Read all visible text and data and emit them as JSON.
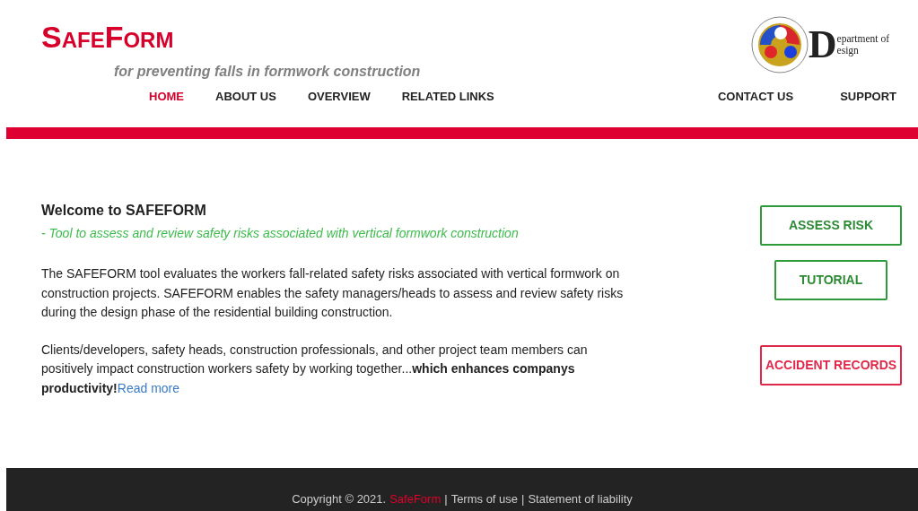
{
  "brand": {
    "title": "SafeForm",
    "tagline": "for preventing falls in formwork construction"
  },
  "dept_logo": {
    "initial": "D",
    "line_1": "epartment of",
    "line_2": "esign"
  },
  "nav_left": [
    {
      "label": "HOME",
      "selected": true
    },
    {
      "label": "ABOUT US",
      "selected": false
    },
    {
      "label": "OVERVIEW",
      "selected": false
    },
    {
      "label": "RELATED LINKS",
      "selected": false
    }
  ],
  "nav_right": [
    {
      "label": "CONTACT US",
      "selected": false
    },
    {
      "label": "SUPPORT",
      "selected": false
    }
  ],
  "welcome": {
    "heading": "Welcome to SAFEFORM",
    "subheading": "- Tool to assess and review safety risks associated with vertical formwork construction",
    "paragraph_1": "The SAFEFORM tool evaluates the workers fall-related safety risks associated with vertical formwork on construction projects. SAFEFORM enables the safety managers/heads to assess and review safety risks during the design phase of the residential building construction.",
    "paragraph_2": "Clients/developers, safety heads, construction professionals, and other project team members can positively impact construction workers safety by working together...**which enhances companys productivity!**",
    "read_more": "Read more"
  },
  "actions": [
    {
      "label": "ASSESS RISK",
      "kind": "primary"
    },
    {
      "label": "TUTORIAL",
      "kind": "primary"
    },
    {
      "label": "ACCIDENT RECORDS",
      "kind": "alert"
    }
  ],
  "footer": {
    "copyright": "Copyright © 2021.",
    "brand": "SafeForm",
    "separator_1": "|",
    "terms": "Terms of use",
    "separator_2": "|",
    "liability": "Statement of liability"
  }
}
